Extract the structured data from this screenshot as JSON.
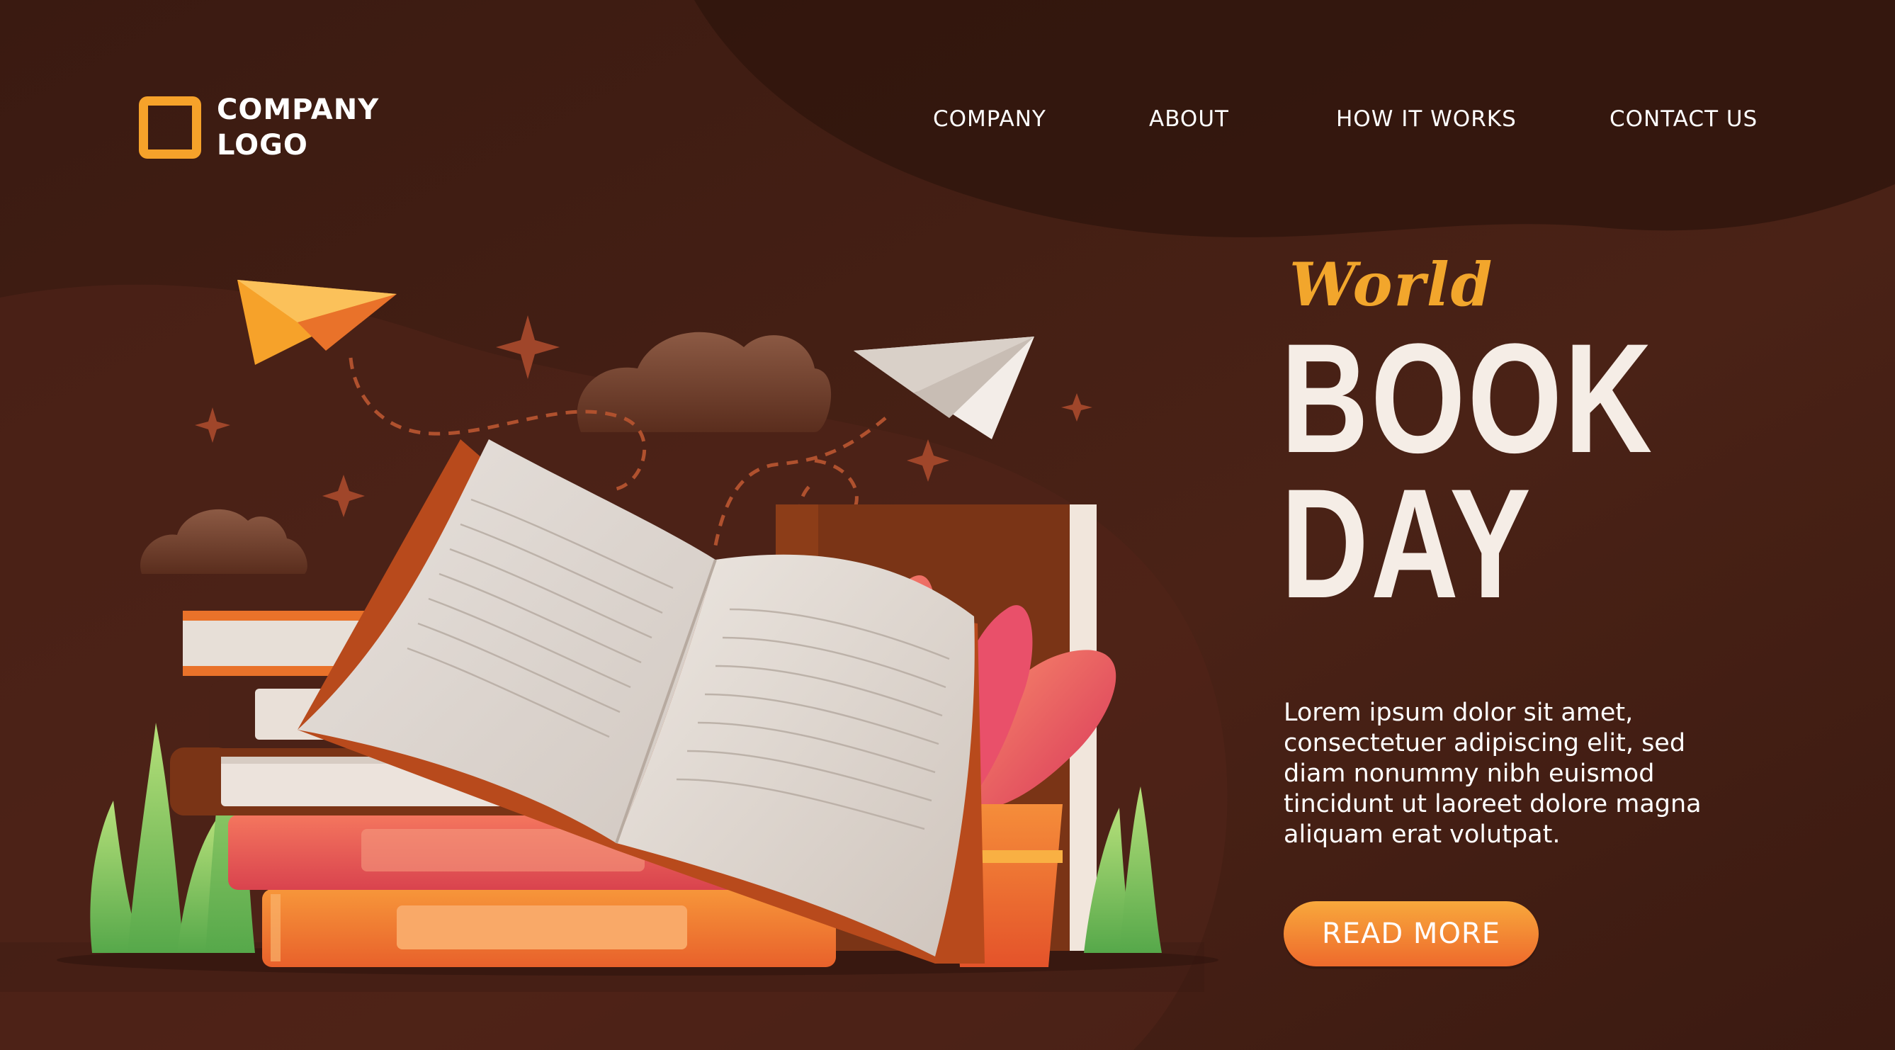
{
  "header": {
    "logo_line1": "COMPANY",
    "logo_line2": "LOGO",
    "nav": [
      {
        "label": "COMPANY"
      },
      {
        "label": "ABOUT"
      },
      {
        "label": "HOW IT WORKS"
      },
      {
        "label": "CONTACT US"
      }
    ]
  },
  "hero": {
    "script_word": "World",
    "title_line1": "BOOK",
    "title_line2": "DAY",
    "description": "Lorem ipsum dolor sit amet, consectetuer adipiscing elit, sed diam nonummy nibh euismod tincidunt ut laoreet dolore magna aliquam erat volutpat.",
    "cta_label": "READ MORE"
  },
  "colors": {
    "background": "#3f1d13",
    "accent": "#f6a22a",
    "title": "#f5ede6",
    "button_top": "#f8a83c",
    "button_bottom": "#ee6a2c"
  },
  "icons": {
    "logo": "square-outline-icon",
    "paper_planes": "paper-plane-icon",
    "sparkles": "sparkle-icon",
    "clouds": "cloud-icon"
  }
}
